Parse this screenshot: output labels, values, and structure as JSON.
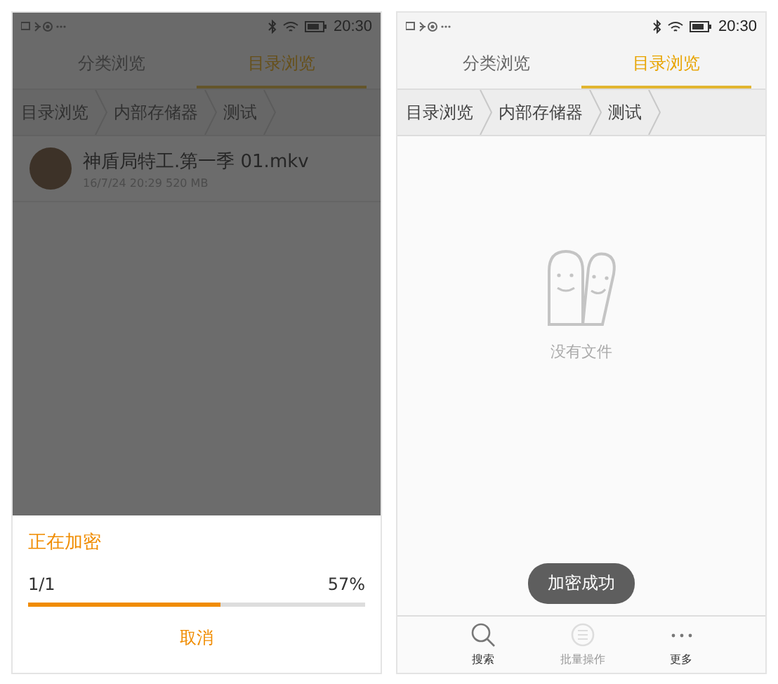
{
  "left_screen": {
    "status_bar": {
      "time": "20:30"
    },
    "tabs": [
      {
        "label": "分类浏览",
        "selected": false
      },
      {
        "label": "目录浏览",
        "selected": true
      }
    ],
    "breadcrumb": [
      "目录浏览",
      "内部存储器",
      "测试"
    ],
    "files": [
      {
        "name": "神盾局特工.第一季  01.mkv",
        "meta": "16/7/24 20:29 520 MB"
      }
    ],
    "dialog": {
      "title": "正在加密",
      "counter": "1/1",
      "percent": "57%",
      "level": 0.57,
      "cancel": "取消"
    }
  },
  "right_screen": {
    "status_bar": {
      "time": "20:30"
    },
    "tabs": [
      {
        "label": "分类浏览",
        "selected": false
      },
      {
        "label": "目录浏览",
        "selected": true
      }
    ],
    "breadcrumb": [
      "目录浏览",
      "内部存储器",
      "测试"
    ],
    "empty_text": "没有文件",
    "toast": "加密成功",
    "toolbar": [
      {
        "kind": "search",
        "label": "搜索",
        "disabled": false
      },
      {
        "kind": "batch",
        "label": "批量操作",
        "disabled": true
      },
      {
        "kind": "more",
        "label": "更多",
        "disabled": false
      }
    ]
  }
}
